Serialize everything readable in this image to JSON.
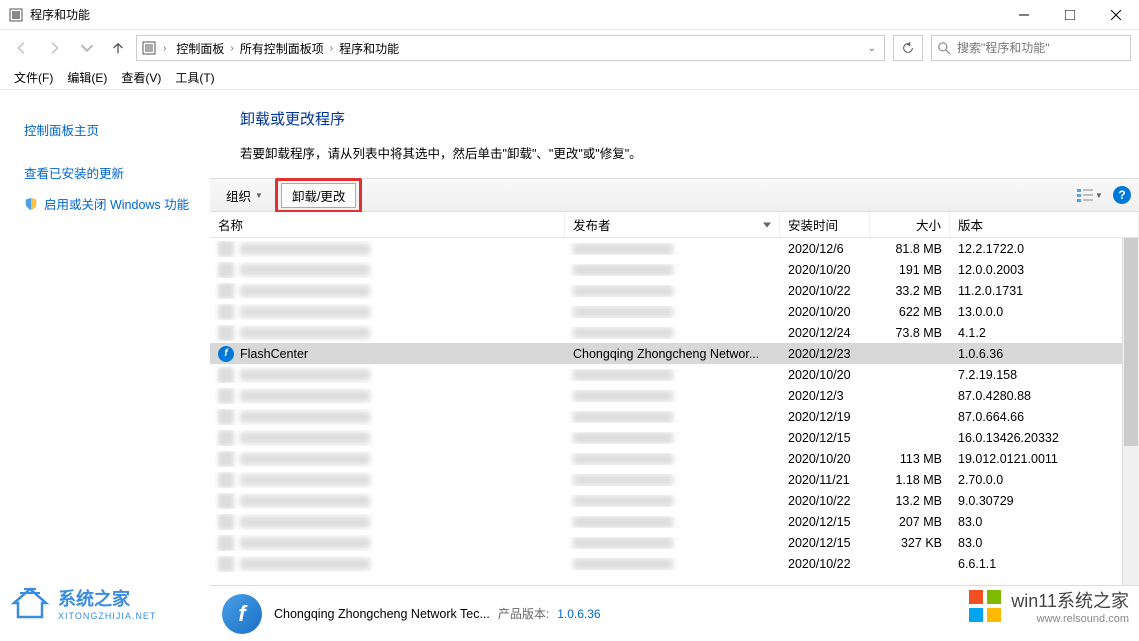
{
  "window": {
    "title": "程序和功能",
    "minimize": "−",
    "restore": "□",
    "close": "✕"
  },
  "breadcrumb": {
    "items": [
      "控制面板",
      "所有控制面板项",
      "程序和功能"
    ]
  },
  "search": {
    "placeholder": "搜索\"程序和功能\""
  },
  "menu": {
    "file": "文件(F)",
    "edit": "编辑(E)",
    "view": "查看(V)",
    "tools": "工具(T)"
  },
  "sidebar": {
    "home": "控制面板主页",
    "updates": "查看已安装的更新",
    "features": "启用或关闭 Windows 功能"
  },
  "header": {
    "title": "卸载或更改程序",
    "desc": "若要卸载程序，请从列表中将其选中，然后单击\"卸载\"、\"更改\"或\"修复\"。"
  },
  "toolbar": {
    "organize": "组织",
    "uninstall": "卸载/更改"
  },
  "columns": {
    "name": "名称",
    "publisher": "发布者",
    "date": "安装时间",
    "size": "大小",
    "version": "版本"
  },
  "rows": [
    {
      "name": "",
      "pub": "",
      "date": "2020/12/6",
      "size": "81.8 MB",
      "ver": "12.2.1722.0",
      "blur": true
    },
    {
      "name": "",
      "pub": "",
      "date": "2020/10/20",
      "size": "191 MB",
      "ver": "12.0.0.2003",
      "blur": true
    },
    {
      "name": "",
      "pub": "",
      "date": "2020/10/22",
      "size": "33.2 MB",
      "ver": "11.2.0.1731",
      "blur": true
    },
    {
      "name": "",
      "pub": "",
      "date": "2020/10/20",
      "size": "622 MB",
      "ver": "13.0.0.0",
      "blur": true
    },
    {
      "name": "",
      "pub": "",
      "date": "2020/12/24",
      "size": "73.8 MB",
      "ver": "4.1.2",
      "blur": true
    },
    {
      "name": "FlashCenter",
      "pub": "Chongqing Zhongcheng Networ...",
      "date": "2020/12/23",
      "size": "",
      "ver": "1.0.6.36",
      "blur": false,
      "selected": true,
      "flash": true
    },
    {
      "name": "",
      "pub": "",
      "date": "2020/10/20",
      "size": "",
      "ver": "7.2.19.158",
      "blur": true
    },
    {
      "name": "",
      "pub": "",
      "date": "2020/12/3",
      "size": "",
      "ver": "87.0.4280.88",
      "blur": true
    },
    {
      "name": "",
      "pub": "",
      "date": "2020/12/19",
      "size": "",
      "ver": "87.0.664.66",
      "blur": true
    },
    {
      "name": "",
      "pub": "",
      "date": "2020/12/15",
      "size": "",
      "ver": "16.0.13426.20332",
      "blur": true
    },
    {
      "name": "",
      "pub": "",
      "date": "2020/10/20",
      "size": "113 MB",
      "ver": "19.012.0121.0011",
      "blur": true
    },
    {
      "name": "",
      "pub": "",
      "date": "2020/11/21",
      "size": "1.18 MB",
      "ver": "2.70.0.0",
      "blur": true
    },
    {
      "name": "",
      "pub": "",
      "date": "2020/10/22",
      "size": "13.2 MB",
      "ver": "9.0.30729",
      "blur": true
    },
    {
      "name": "",
      "pub": "",
      "date": "2020/12/15",
      "size": "207 MB",
      "ver": "83.0",
      "blur": true
    },
    {
      "name": "",
      "pub": "",
      "date": "2020/12/15",
      "size": "327 KB",
      "ver": "83.0",
      "blur": true
    },
    {
      "name": "",
      "pub": "",
      "date": "2020/10/22",
      "size": "",
      "ver": "6.6.1.1",
      "blur": true
    }
  ],
  "details": {
    "name": "Chongqing Zhongcheng Network Tec...",
    "label": "产品版本:",
    "value": "1.0.6.36"
  },
  "watermark1": {
    "title": "系统之家",
    "sub": "XITONGZHIJIA.NET"
  },
  "watermark2": {
    "title": "win11系统之家",
    "sub": "www.relsound.com"
  }
}
